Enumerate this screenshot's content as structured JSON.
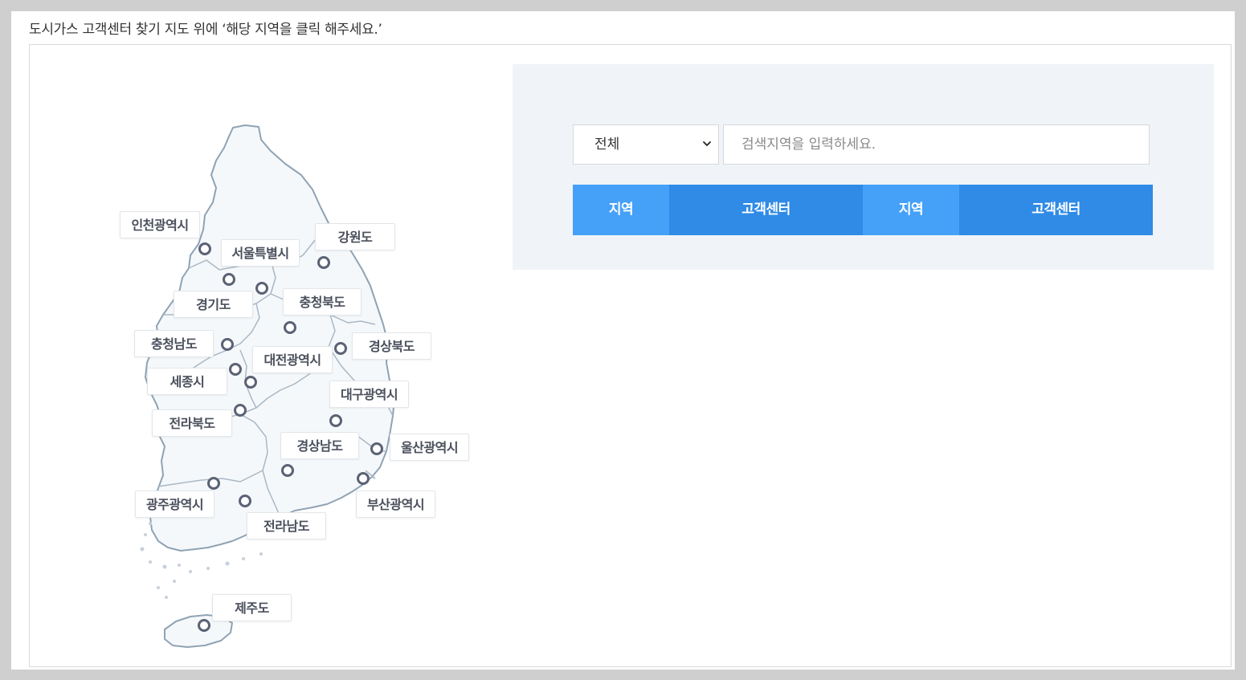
{
  "intro_text": "도시가스 고객센터 찾기 지도 위에 ‘해당 지역을 클릭 해주세요.’",
  "map": {
    "regions": [
      {
        "key": "incheon",
        "label": "인천광역시"
      },
      {
        "key": "seoul",
        "label": "서울특별시"
      },
      {
        "key": "gangwon",
        "label": "강원도"
      },
      {
        "key": "gyeonggi",
        "label": "경기도"
      },
      {
        "key": "chungbuk",
        "label": "충청북도"
      },
      {
        "key": "chungnam",
        "label": "충청남도"
      },
      {
        "key": "daejeon",
        "label": "대전광역시"
      },
      {
        "key": "gyeongbuk",
        "label": "경상북도"
      },
      {
        "key": "sejong",
        "label": "세종시"
      },
      {
        "key": "daegu",
        "label": "대구광역시"
      },
      {
        "key": "jeonbuk",
        "label": "전라북도"
      },
      {
        "key": "gyeongnam",
        "label": "경상남도"
      },
      {
        "key": "ulsan",
        "label": "울산광역시"
      },
      {
        "key": "gwangju",
        "label": "광주광역시"
      },
      {
        "key": "busan",
        "label": "부산광역시"
      },
      {
        "key": "jeonnam",
        "label": "전라남도"
      },
      {
        "key": "jeju",
        "label": "제주도"
      }
    ]
  },
  "search": {
    "selected_option": "전체",
    "placeholder": "검색지역을 입력하세요."
  },
  "tabs": [
    {
      "label": "지역"
    },
    {
      "label": "고객센터"
    },
    {
      "label": "지역"
    },
    {
      "label": "고객센터"
    }
  ],
  "colors": {
    "tab_region": "#45a0f8",
    "tab_center": "#2f8be6",
    "panel_bg": "#f0f4f8",
    "map_fill": "#f5f8fb",
    "map_stroke": "#8fa3b4",
    "pin": "#5a6274"
  }
}
